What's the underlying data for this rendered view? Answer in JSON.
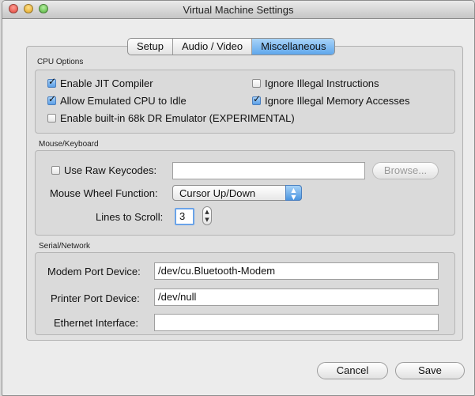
{
  "window": {
    "title": "Virtual Machine Settings"
  },
  "tabs": [
    "Setup",
    "Audio / Video",
    "Miscellaneous"
  ],
  "active_tab": "Miscellaneous",
  "cpu": {
    "section_label": "CPU Options",
    "enable_jit": {
      "label": "Enable JIT Compiler",
      "checked": true
    },
    "allow_idle": {
      "label": "Allow Emulated CPU to Idle",
      "checked": true
    },
    "enable_dr": {
      "label": "Enable built-in 68k DR Emulator (EXPERIMENTAL)",
      "checked": false
    },
    "ignore_illegal_instr": {
      "label": "Ignore Illegal Instructions",
      "checked": false
    },
    "ignore_illegal_mem": {
      "label": "Ignore Illegal Memory Accesses",
      "checked": true
    }
  },
  "mouse": {
    "section_label": "Mouse/Keyboard",
    "raw_keycodes": {
      "label": "Use Raw Keycodes:",
      "checked": false,
      "value": ""
    },
    "browse_label": "Browse...",
    "wheel_label": "Mouse Wheel Function:",
    "wheel_value": "Cursor Up/Down",
    "lines_label": "Lines to Scroll:",
    "lines_value": "3"
  },
  "serial": {
    "section_label": "Serial/Network",
    "modem_label": "Modem Port Device:",
    "modem_value": "/dev/cu.Bluetooth-Modem",
    "printer_label": "Printer Port Device:",
    "printer_value": "/dev/null",
    "ethernet_label": "Ethernet Interface:",
    "ethernet_value": ""
  },
  "buttons": {
    "cancel": "Cancel",
    "save": "Save"
  },
  "icons": {
    "close": "close-icon",
    "minimize": "minimize-icon",
    "zoom": "zoom-icon",
    "popup_arrows": "up-down-arrows-icon",
    "stepper": "stepper-icon"
  },
  "colors": {
    "accent": "#5fa7ec",
    "window_bg": "#ececec",
    "panel_bg": "#e1e1e1"
  }
}
